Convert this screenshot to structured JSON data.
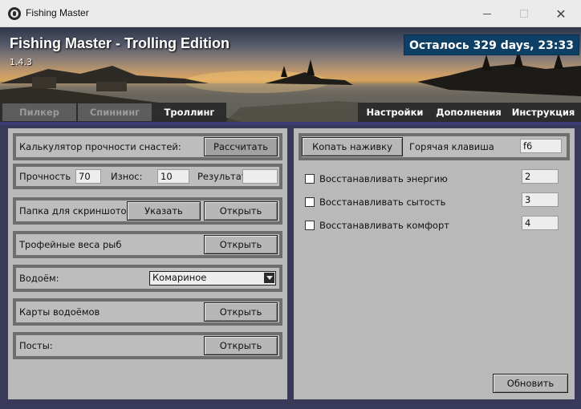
{
  "window": {
    "title": "Fishing Master"
  },
  "banner": {
    "title": "Fishing Master - Trolling Edition",
    "version": "1.4.3",
    "timer": "Осталось 329 days, 23:33"
  },
  "tabs_left": [
    {
      "label": "Пилкер",
      "active": false
    },
    {
      "label": "Спиннинг",
      "active": false
    },
    {
      "label": "Троллинг",
      "active": true
    }
  ],
  "tabs_right": [
    {
      "label": "Настройки"
    },
    {
      "label": "Дополнения"
    },
    {
      "label": "Инструкция"
    }
  ],
  "left": {
    "strength_calc": {
      "label": "Калькулятор прочности снастей:",
      "button": "Рассчитать"
    },
    "strength": {
      "label": "Прочность",
      "value": "70",
      "wear_label": "Износ:",
      "wear_value": "10",
      "result_label": "Результат:",
      "result_value": ""
    },
    "screenshots": {
      "label": "Папка для скриншотов:",
      "set_button": "Указать",
      "open_button": "Открыть"
    },
    "trophy": {
      "label": "Трофейные веса рыб",
      "open_button": "Открыть"
    },
    "water": {
      "label": "Водоём:",
      "selected": "Комариное"
    },
    "maps": {
      "label": "Карты водоёмов",
      "open_button": "Открыть"
    },
    "posts": {
      "label": "Посты:",
      "open_button": "Открыть"
    }
  },
  "right": {
    "dig_button": "Копать наживку",
    "hotkey_label": "Горячая клавиша",
    "hotkey_value": "f6",
    "options": [
      {
        "label": "Восстанавливать энергию",
        "value": "2",
        "checked": false
      },
      {
        "label": "Восстанавливать сытость",
        "value": "3",
        "checked": false
      },
      {
        "label": "Восстанавливать комфорт",
        "value": "4",
        "checked": false
      }
    ],
    "refresh_button": "Обновить"
  }
}
